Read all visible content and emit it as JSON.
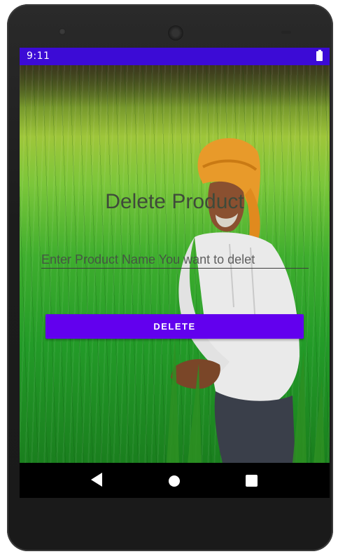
{
  "status_bar": {
    "time": "9:11",
    "battery_icon": "battery-full-icon",
    "color": "#3c0bd6"
  },
  "app": {
    "title": "Delete Product",
    "product_input": {
      "placeholder": "Enter Product Name You want to delet",
      "value": ""
    },
    "delete_button": {
      "label": "DELETE",
      "color": "#6200ee"
    },
    "background_image": "farmer-in-wheat-field"
  },
  "nav_bar": {
    "back_icon": "back-triangle-icon",
    "home_icon": "home-circle-icon",
    "recents_icon": "recents-square-icon"
  }
}
